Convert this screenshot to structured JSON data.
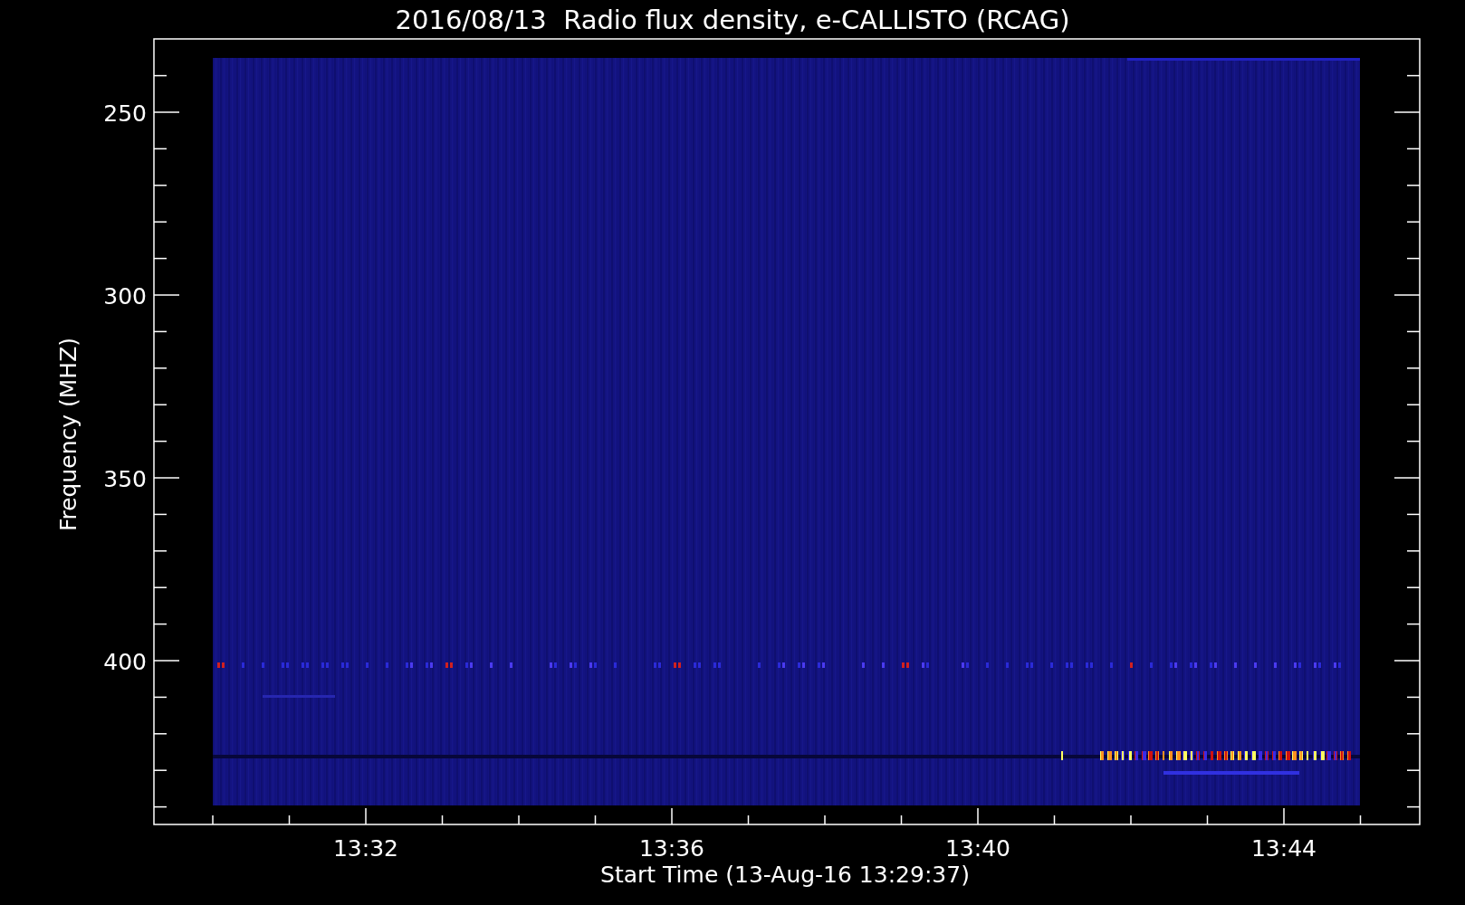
{
  "plot": {
    "title": "2016/08/13  Radio flux density, e-CALLISTO (RCAG)",
    "ylabel": "Frequency (MHZ)",
    "xlabel": "Start Time (13-Aug-16 13:29:37)",
    "yticks": [
      "250",
      "300",
      "350",
      "400"
    ],
    "xticks": [
      "13:32",
      "13:36",
      "13:40",
      "13:44"
    ]
  }
}
